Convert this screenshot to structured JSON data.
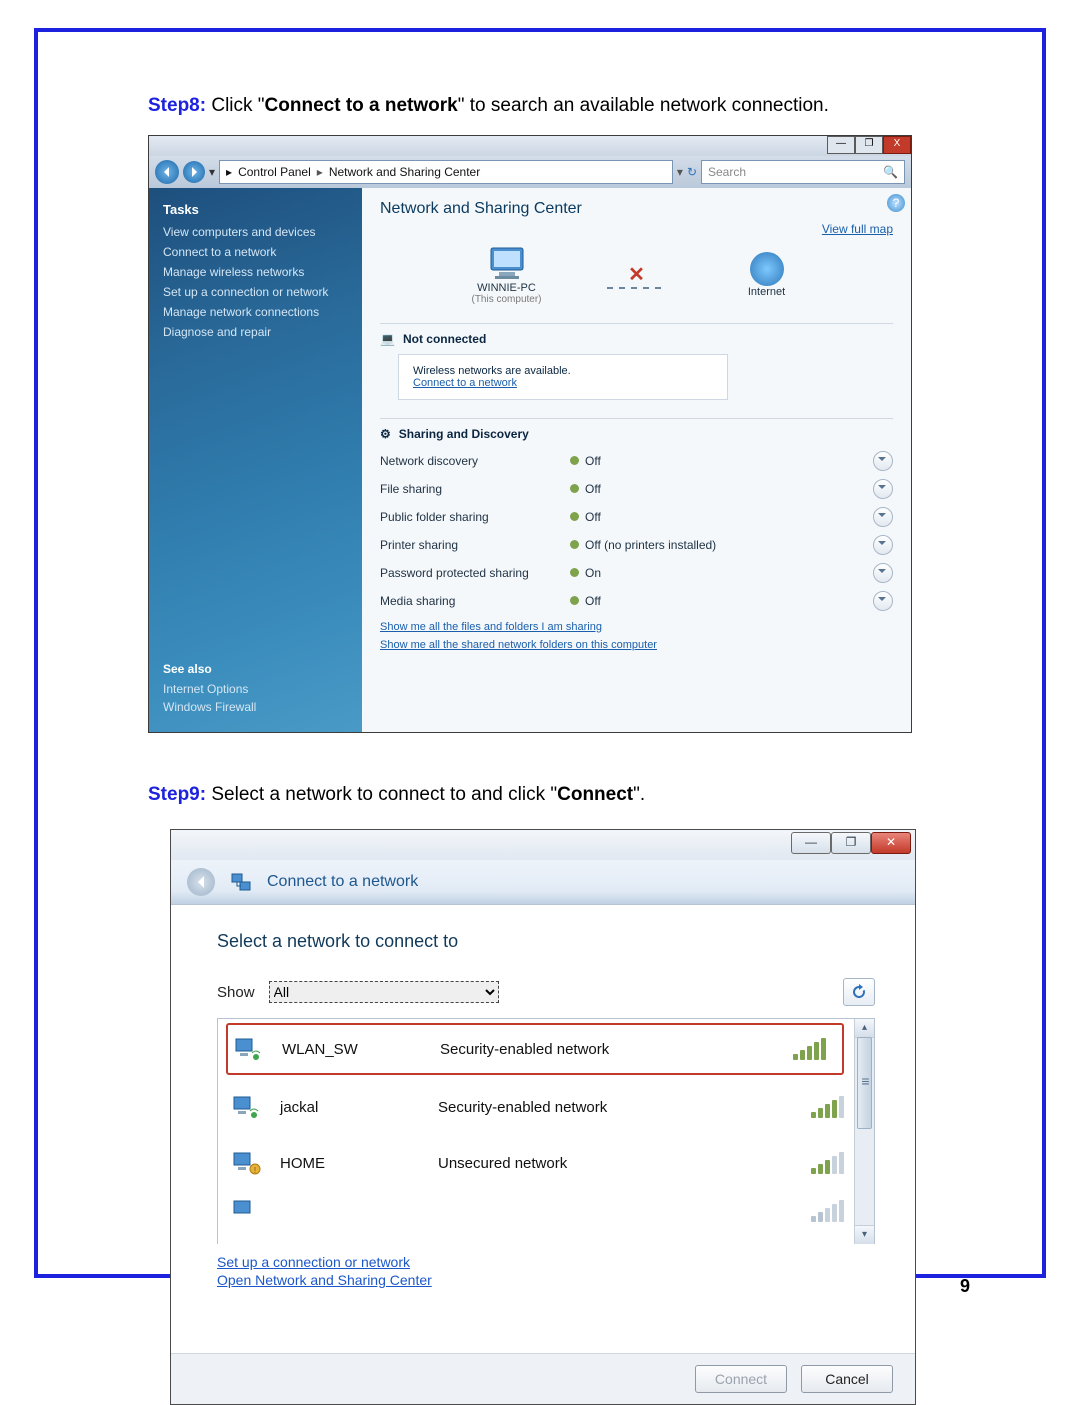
{
  "page_number": "9",
  "step8": {
    "label": "Step8:",
    "text_a": " Click \"",
    "bold": "Connect to a network",
    "text_b": "\" to search an available network connection."
  },
  "step9": {
    "label": "Step9:",
    "text_a": " Select a network to connect to and click \"",
    "bold": "Connect",
    "text_b": "\"."
  },
  "shot1": {
    "win_min": "—",
    "win_max": "❐",
    "win_close": "X",
    "breadcrumb_a": "Control Panel",
    "breadcrumb_b": "Network and Sharing Center",
    "search_placeholder": "Search",
    "help": "?",
    "tasks_title": "Tasks",
    "tasks": {
      "t0": "View computers and devices",
      "t1": "Connect to a network",
      "t2": "Manage wireless networks",
      "t3": "Set up a connection or network",
      "t4": "Manage network connections",
      "t5": "Diagnose and repair"
    },
    "seealso_title": "See also",
    "seealso": {
      "a": "Internet Options",
      "b": "Windows Firewall"
    },
    "content_title": "Network and Sharing Center",
    "fullmap": "View full map",
    "pc_name": "WINNIE-PC",
    "pc_sub": "(This computer)",
    "internet": "Internet",
    "map_x": "✕",
    "notconnected": "Not connected",
    "wireless_avail": "Wireless networks are available.",
    "connect_link": "Connect to a network",
    "sharing_title": "Sharing and Discovery",
    "rows": {
      "r0": {
        "lbl": "Network discovery",
        "val": "Off"
      },
      "r1": {
        "lbl": "File sharing",
        "val": "Off"
      },
      "r2": {
        "lbl": "Public folder sharing",
        "val": "Off"
      },
      "r3": {
        "lbl": "Printer sharing",
        "val": "Off (no printers installed)"
      },
      "r4": {
        "lbl": "Password protected sharing",
        "val": "On"
      },
      "r5": {
        "lbl": "Media sharing",
        "val": "Off"
      }
    },
    "showme_a": "Show me all the files and folders I am sharing",
    "showme_b": "Show me all the shared network folders on this computer"
  },
  "shot2": {
    "win_min": "—",
    "win_max": "❐",
    "win_close": "✕",
    "title": "Connect to a network",
    "heading": "Select a network to connect to",
    "show_label": "Show",
    "show_value": "All",
    "scroll_up": "▴",
    "scroll_down": "▾",
    "scroll_grip": "≡",
    "networks": {
      "n0": {
        "name": "WLAN_SW",
        "type": "Security-enabled network"
      },
      "n1": {
        "name": "jackal",
        "type": "Security-enabled network"
      },
      "n2": {
        "name": "HOME",
        "type": "Unsecured network"
      }
    },
    "link_a": "Set up a connection or network",
    "link_b": "Open Network and Sharing Center",
    "btn_connect": "Connect",
    "btn_cancel": "Cancel"
  }
}
